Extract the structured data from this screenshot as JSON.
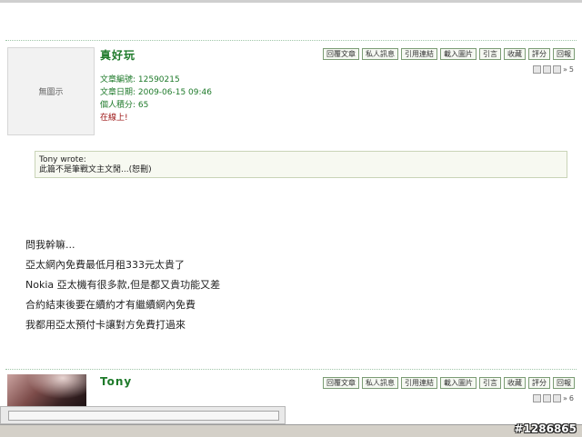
{
  "posts": [
    {
      "author": "真好玩",
      "avatar_text": "無圖示",
      "meta": {
        "post_id": "文章編號: 12590215",
        "post_date": "文章日期: 2009-06-15 09:46",
        "points": "個人積分: 65",
        "status": "在線上!"
      },
      "floor": "5",
      "quote": {
        "author": "Tony wrote:",
        "text": "此篇不是筆戰文主文閒...(恕刪)"
      },
      "lines": [
        "問我幹嘛...",
        "亞太網內免費最低月租333元太貴了",
        "Nokia 亞太機有很多款,但是都又貴功能又差",
        "合約結束後要在續約才有繼續網內免費",
        "我都用亞太預付卡讓對方免費打過來"
      ]
    },
    {
      "author": "Tony",
      "floor": "6"
    }
  ],
  "toolbar": [
    "回覆文章",
    "私人訊息",
    "引用連結",
    "載入圖片",
    "引言",
    "收藏",
    "評分",
    "回報"
  ],
  "watermark": "#1286865"
}
